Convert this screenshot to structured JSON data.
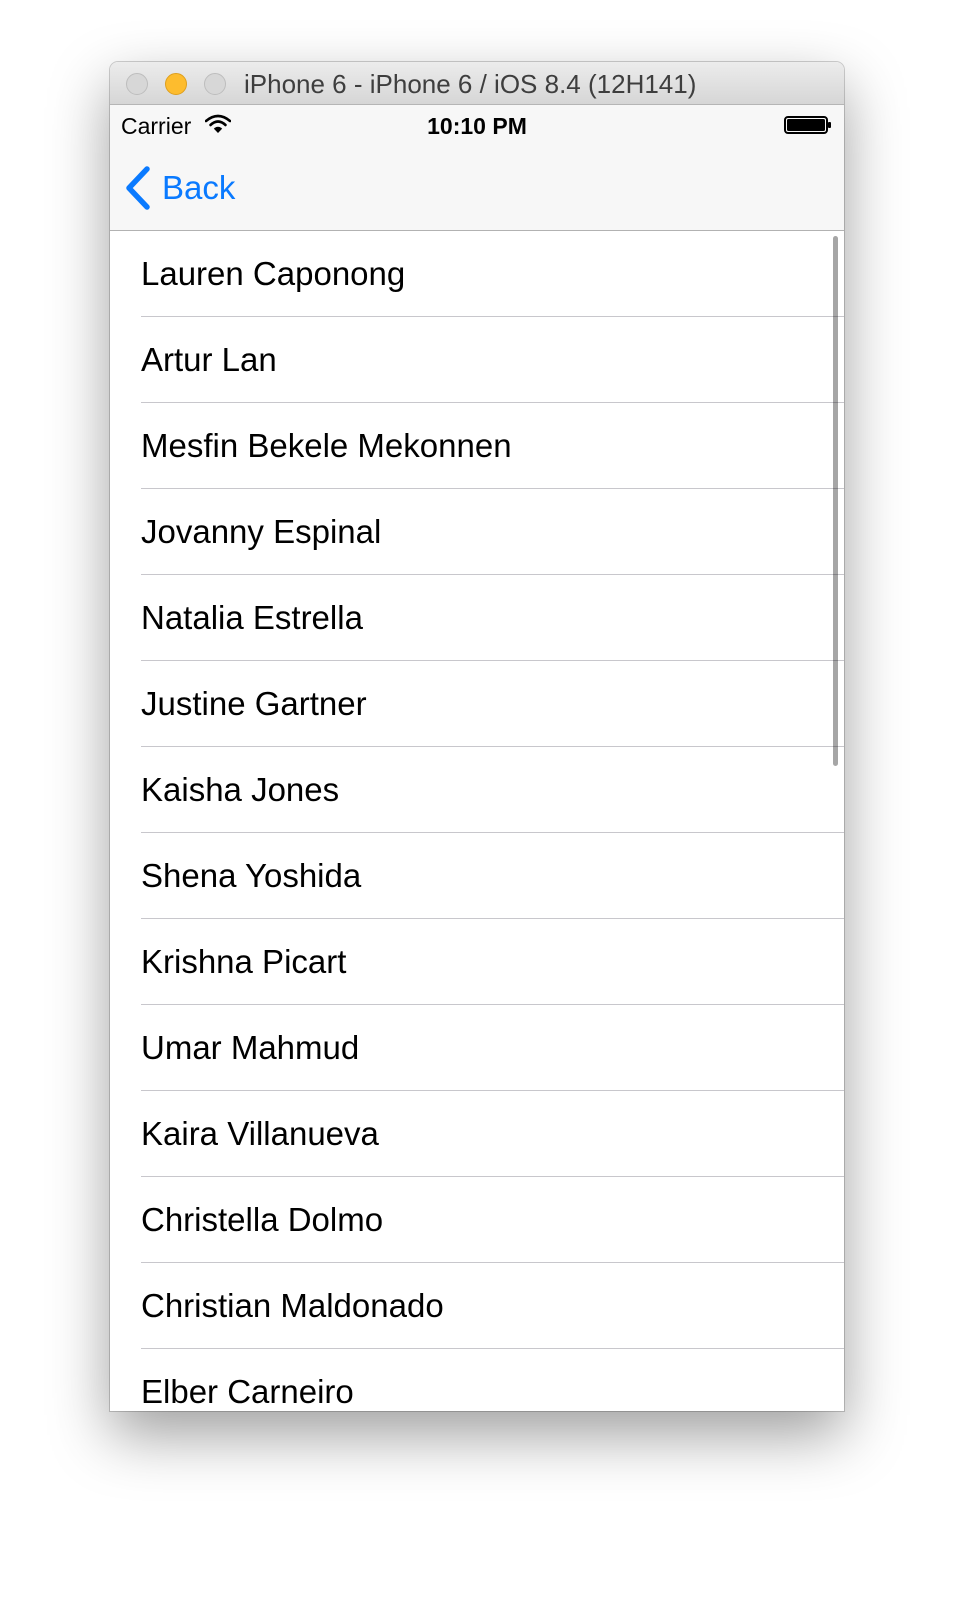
{
  "window": {
    "title": "iPhone 6 - iPhone 6 / iOS 8.4 (12H141)"
  },
  "statusbar": {
    "carrier": "Carrier",
    "time": "10:10 PM",
    "signal_icon": "wifi-icon",
    "battery_icon": "battery-icon"
  },
  "navbar": {
    "back_label": "Back",
    "back_icon": "chevron-left-icon",
    "tint_color": "#0A7AFF"
  },
  "list": {
    "items": [
      "Lauren Caponong",
      "Artur Lan",
      "Mesfin Bekele Mekonnen",
      "Jovanny Espinal",
      "Natalia Estrella",
      "Justine Gartner",
      "Kaisha Jones",
      "Shena Yoshida",
      "Krishna Picart",
      "Umar Mahmud",
      "Kaira Villanueva",
      "Christella Dolmo",
      "Christian Maldonado",
      "Elber Carneiro"
    ]
  }
}
